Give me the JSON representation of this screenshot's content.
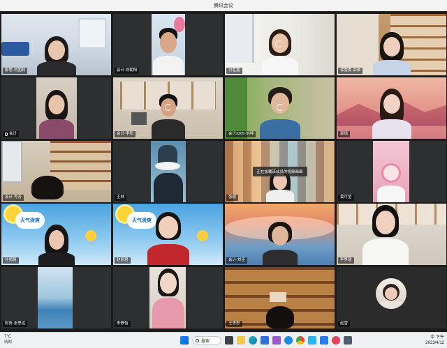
{
  "window": {
    "title": "腾讯会议"
  },
  "tiles": [
    {
      "label": "郁思·刘国莉",
      "mic": false
    },
    {
      "label": "会计·刘朝阳",
      "mic": false
    },
    {
      "label": "付茗嘉",
      "mic": false
    },
    {
      "label": "保管委·郭雅",
      "mic": false
    },
    {
      "label": "会计",
      "mic": true
    },
    {
      "label": "会计·李阳",
      "mic": false
    },
    {
      "label": "会计2205·刘坤",
      "mic": false
    },
    {
      "label": "郭琦",
      "mic": false
    },
    {
      "label": "会计·肖芳",
      "mic": false
    },
    {
      "label": "王林",
      "mic": false
    },
    {
      "label": "张颖",
      "mic": false
    },
    {
      "label": "黄可莹",
      "mic": false
    },
    {
      "label": "孙雨萌",
      "mic": false
    },
    {
      "label": "赵丽君",
      "mic": false
    },
    {
      "label": "会计·刘佳",
      "mic": false
    },
    {
      "label": "李梦瑶",
      "mic": false
    },
    {
      "label": "财务·张思远",
      "mic": false
    },
    {
      "label": "李静怡",
      "mic": false
    },
    {
      "label": "王思思",
      "mic": false
    },
    {
      "label": "赵雪",
      "mic": false
    }
  ],
  "overlay": {
    "toast": "正在加载该成员的视频画面"
  },
  "stickers": {
    "weather_text": "天气清爽"
  },
  "taskbar": {
    "temperature": "7°C",
    "weather_desc": "晴朗",
    "search_label": "搜索",
    "tray_line1": "下午",
    "tray_line2": "2023/4/12",
    "lang": "中"
  },
  "colors": {
    "taskbar": "#eef0f4",
    "tile_bg": "#2b2b2b",
    "accent": "#0a64d6"
  }
}
